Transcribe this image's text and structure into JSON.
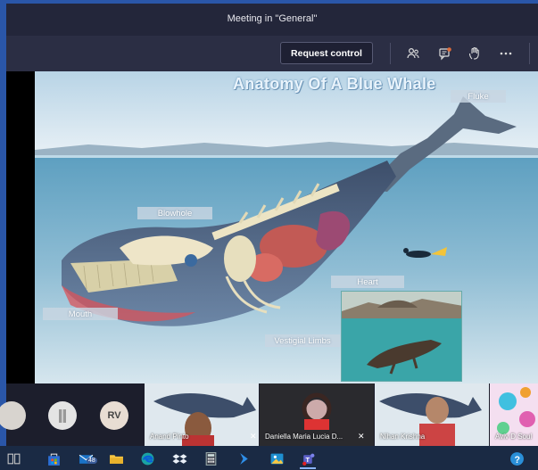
{
  "window": {
    "title": "Meeting in \"General\""
  },
  "toolbar": {
    "request_control_label": "Request control",
    "icons": [
      "people-icon",
      "chat-icon",
      "raise-hand-icon",
      "more-icon"
    ]
  },
  "slide": {
    "title": "Anatomy Of A Blue Whale",
    "labels": {
      "fluke": "Fluke",
      "blowhole": "Blowhole",
      "heart": "Heart",
      "mouth": "Mouth",
      "vestigial_limbs": "Vestigial Limbs"
    }
  },
  "participants": {
    "avatars": [
      {
        "initials": "",
        "icon": "user-photo"
      },
      {
        "initials": "",
        "icon": "user-photo"
      },
      {
        "initials": "RV",
        "color": "#e8ddd3"
      }
    ],
    "tiles": [
      {
        "name": "Anand Pinto",
        "muted": true
      },
      {
        "name": "Daniella Maria Lucia D...",
        "muted": true
      },
      {
        "name": "Nihan Krishna",
        "muted": false
      },
      {
        "name": "Aviv D Soul",
        "muted": false
      }
    ]
  },
  "taskbar": {
    "mail_badge": "48",
    "help_icon": "?",
    "apps": [
      "store-icon",
      "mail-icon",
      "file-explorer-icon",
      "edge-icon",
      "dropbox-icon",
      "calculator-icon",
      "power-automate-icon",
      "photos-icon",
      "teams-icon"
    ]
  },
  "colors": {
    "accent": "#2a56a8",
    "titlebar": "#23263a",
    "toolbar": "#2b2e44"
  }
}
